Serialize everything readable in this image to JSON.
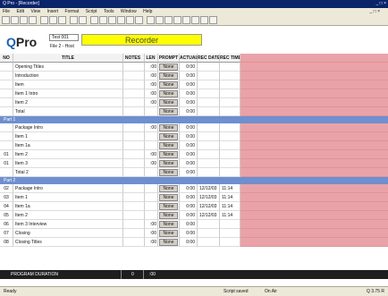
{
  "window": {
    "title": "Q Pro - [Recorder]",
    "controls": "_ □ ×"
  },
  "menu": {
    "items": [
      "File",
      "Edit",
      "View",
      "Insert",
      "Format",
      "Script",
      "Tools",
      "Window",
      "Help"
    ],
    "mdi_controls": "_ □ ×"
  },
  "toolbar": {
    "buttons": [
      "new",
      "open",
      "save",
      "print",
      "cut",
      "copy",
      "paste",
      "find",
      "undo",
      "redo",
      "bold",
      "italic",
      "left",
      "center",
      "right",
      "grid",
      "table",
      "insert",
      "delete",
      "record",
      "stop",
      "play",
      "zoom"
    ]
  },
  "header": {
    "logo_q": "Q",
    "logo_text": "Pro",
    "selector_value": "Test 001",
    "file_label": "File 2 - Host",
    "banner": "Recorder"
  },
  "columns": [
    "NO",
    "TITLE",
    "NOTES",
    "LEN",
    "PROMPT",
    "ACTUAL",
    "REC DATE",
    "REC TIME"
  ],
  "groups": [
    {
      "section": "",
      "rows": [
        {
          "no": "",
          "title": "Opening Titles",
          "notes": "",
          "len": ":00",
          "prompt": "None",
          "actual": "0:00",
          "rec": "",
          "tc": ""
        },
        {
          "no": "",
          "title": "Introduction",
          "notes": "",
          "len": ":00",
          "prompt": "None",
          "actual": "0:00",
          "rec": "",
          "tc": ""
        },
        {
          "no": "",
          "title": "Item",
          "notes": "",
          "len": ":00",
          "prompt": "None",
          "actual": "0:00",
          "rec": "",
          "tc": ""
        },
        {
          "no": "",
          "title": "Item 1 Intro",
          "notes": "",
          "len": ":00",
          "prompt": "None",
          "actual": "0:00",
          "rec": "",
          "tc": ""
        },
        {
          "no": "",
          "title": "Item 2",
          "notes": "",
          "len": ":00",
          "prompt": "None",
          "actual": "0:00",
          "rec": "",
          "tc": ""
        }
      ],
      "total": {
        "title": "Total",
        "prompt": "None",
        "actual": "0:00"
      }
    },
    {
      "section": "Part 1",
      "rows": [
        {
          "no": "",
          "title": "Package Intro",
          "notes": "",
          "len": ":00",
          "prompt": "None",
          "actual": "0:00",
          "rec": "",
          "tc": ""
        },
        {
          "no": "",
          "title": "Item 1",
          "notes": "",
          "len": "",
          "prompt": "None",
          "actual": "0:00",
          "rec": "",
          "tc": ""
        },
        {
          "no": "",
          "title": "Item 1a",
          "notes": "",
          "len": "",
          "prompt": "None",
          "actual": "0:00",
          "rec": "",
          "tc": ""
        },
        {
          "no": "01",
          "title": "Item 2",
          "notes": "",
          "len": ":00",
          "prompt": "None",
          "actual": "0:00",
          "rec": "",
          "tc": ""
        },
        {
          "no": "01",
          "title": "Item 3",
          "notes": "",
          "len": ":00",
          "prompt": "None",
          "actual": "0:00",
          "rec": "",
          "tc": ""
        }
      ],
      "total": {
        "title": "Total 2",
        "prompt": "None",
        "actual": "0:00"
      }
    },
    {
      "section": "Part 2",
      "rows": [
        {
          "no": "02",
          "title": "Package Intro",
          "notes": "",
          "len": "",
          "prompt": "None",
          "actual": "0:00",
          "rec": "12/12/03",
          "tc": "11:14"
        },
        {
          "no": "03",
          "title": "Item 1",
          "notes": "",
          "len": "",
          "prompt": "None",
          "actual": "0:00",
          "rec": "12/12/03",
          "tc": "11:14"
        },
        {
          "no": "04",
          "title": "Item 1a",
          "notes": "",
          "len": "",
          "prompt": "None",
          "actual": "0:00",
          "rec": "12/12/03",
          "tc": "11:14"
        },
        {
          "no": "05",
          "title": "Item 2",
          "notes": "",
          "len": "",
          "prompt": "None",
          "actual": "0:00",
          "rec": "12/12/03",
          "tc": "11:14"
        },
        {
          "no": "06",
          "title": "Item 3 Interview",
          "notes": "",
          "len": ":00",
          "prompt": "None",
          "actual": "0:00",
          "rec": "",
          "tc": ""
        },
        {
          "no": "07",
          "title": "Closing",
          "notes": "",
          "len": ":00",
          "prompt": "None",
          "actual": "0:00",
          "rec": "",
          "tc": ""
        },
        {
          "no": "08",
          "title": "Closing Titles",
          "notes": "",
          "len": ":00",
          "prompt": "None",
          "actual": "0:00",
          "rec": "",
          "tc": ""
        }
      ],
      "total": null
    }
  ],
  "footer": {
    "label": "PROGRAM DURATION",
    "value1": "0",
    "value2": ":00"
  },
  "statusbar": {
    "ready": "Ready",
    "s2": "Script saved",
    "s3": "On Air",
    "s4": "Q 3.75 R"
  },
  "colors": {
    "accent": "#0a246a",
    "section": "#6e8fd0",
    "pink": "#e9a3a8",
    "banner": "#ffff00"
  }
}
